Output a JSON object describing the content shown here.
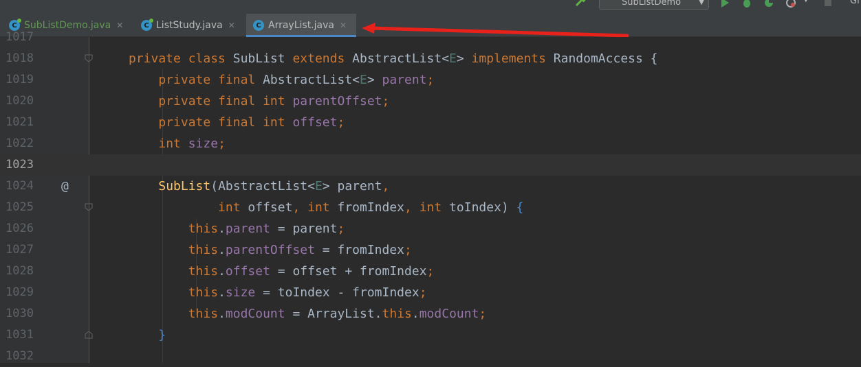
{
  "toolbar": {
    "run_config": "SubListDemo",
    "git_label": "Gi"
  },
  "tabs": [
    {
      "name": "SubListDemo.java",
      "active": false,
      "icon_letter": "C"
    },
    {
      "name": "ListStudy.java",
      "active": false,
      "icon_letter": "C"
    },
    {
      "name": "ArrayList.java",
      "active": true,
      "icon_letter": "C"
    }
  ],
  "colors": {
    "keyword": "#cc7832",
    "field": "#9876aa",
    "type_param": "#507874",
    "method": "#ffc66d",
    "text": "#a9b7c6",
    "annotation_arrow": "#e8211a"
  },
  "editor": {
    "line_numbers": [
      "1017",
      "1018",
      "1019",
      "1020",
      "1021",
      "1022",
      "1023",
      "1024",
      "1025",
      "1026",
      "1027",
      "1028",
      "1029",
      "1030",
      "1031",
      "1032"
    ],
    "current_line": "1023",
    "gutter_marker": "@",
    "code": [
      "",
      "private class SubList extends AbstractList<E> implements RandomAccess {",
      "    private final AbstractList<E> parent;",
      "    private final int parentOffset;",
      "    private final int offset;",
      "    int size;",
      "",
      "    SubList(AbstractList<E> parent,",
      "            int offset, int fromIndex, int toIndex) {",
      "        this.parent = parent;",
      "        this.parentOffset = fromIndex;",
      "        this.offset = offset + fromIndex;",
      "        this.size = toIndex - fromIndex;",
      "        this.modCount = ArrayList.this.modCount;",
      "    }",
      ""
    ]
  },
  "tokens": {
    "private": "private",
    "class": "class",
    "extends": "extends",
    "implements": "implements",
    "final": "final",
    "int": "int",
    "this": "this",
    "SubList": "SubList",
    "AbstractList": "AbstractList",
    "E": "E",
    "RandomAccess": "RandomAccess",
    "ArrayList": "ArrayList",
    "parent": "parent",
    "parentOffset": "parentOffset",
    "offset": "offset",
    "size": "size",
    "modCount": "modCount",
    "fromIndex": "fromIndex",
    "toIndex": "toIndex"
  }
}
